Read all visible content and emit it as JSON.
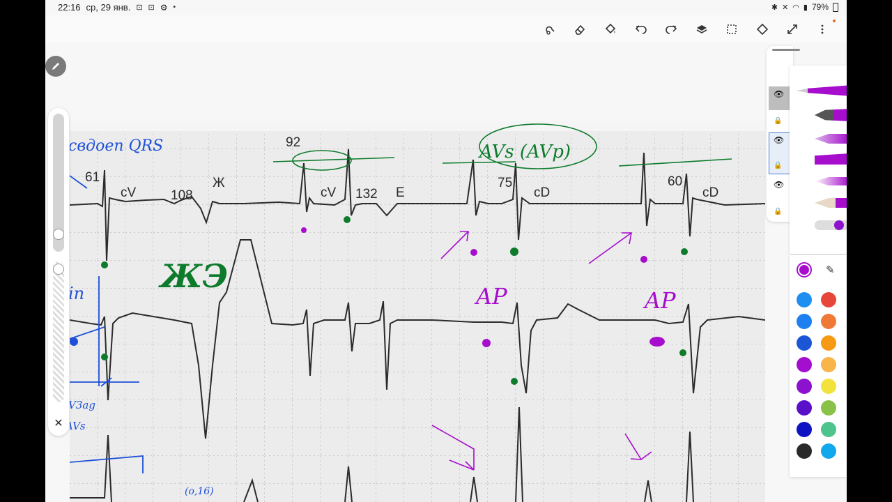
{
  "status": {
    "time": "22:16",
    "date": "ср, 29 янв.",
    "battery": "79%"
  },
  "toolbar": {
    "icons": [
      "lasso-icon",
      "eraser-icon",
      "fill-icon",
      "undo-icon",
      "redo-icon",
      "layers-icon",
      "select-icon",
      "transform-icon",
      "expand-icon",
      "more-icon"
    ]
  },
  "ecg": {
    "labels": {
      "header_note": "свдоеп QRS",
      "val_61": "61",
      "cv1": "cV",
      "val_108": "108",
      "zh": "Ж",
      "val_92": "92",
      "cv2": "cV",
      "val_132": "132",
      "e": "E",
      "avs": "AVs (AVp)",
      "val_75": "75",
      "cd1": "cD",
      "val_60": "60",
      "cd2": "cD",
      "zhe": "ЖЭ",
      "ap1": "AP",
      "ap2": "AP",
      "in_note": "in",
      "v3_note": "V3ag",
      "vs_note": "AVs",
      "bottom_note": "(o,16)"
    }
  },
  "colors": {
    "purple": "#a60dcc",
    "green": "#0e7b2c",
    "blue": "#1e50d8",
    "ecg": "#2b2b2b"
  },
  "palette": [
    "#1e8ff0",
    "#e8463b",
    "#1e7ff0",
    "#ef7a35",
    "#1a56d6",
    "#f59a12",
    "#a40fcf",
    "#f7b54a",
    "#8c12d0",
    "#f4e23c",
    "#5a10c9",
    "#8ac249",
    "#0f14c2",
    "#4dc48c",
    "#2a2a2a",
    "#13a7ee"
  ]
}
